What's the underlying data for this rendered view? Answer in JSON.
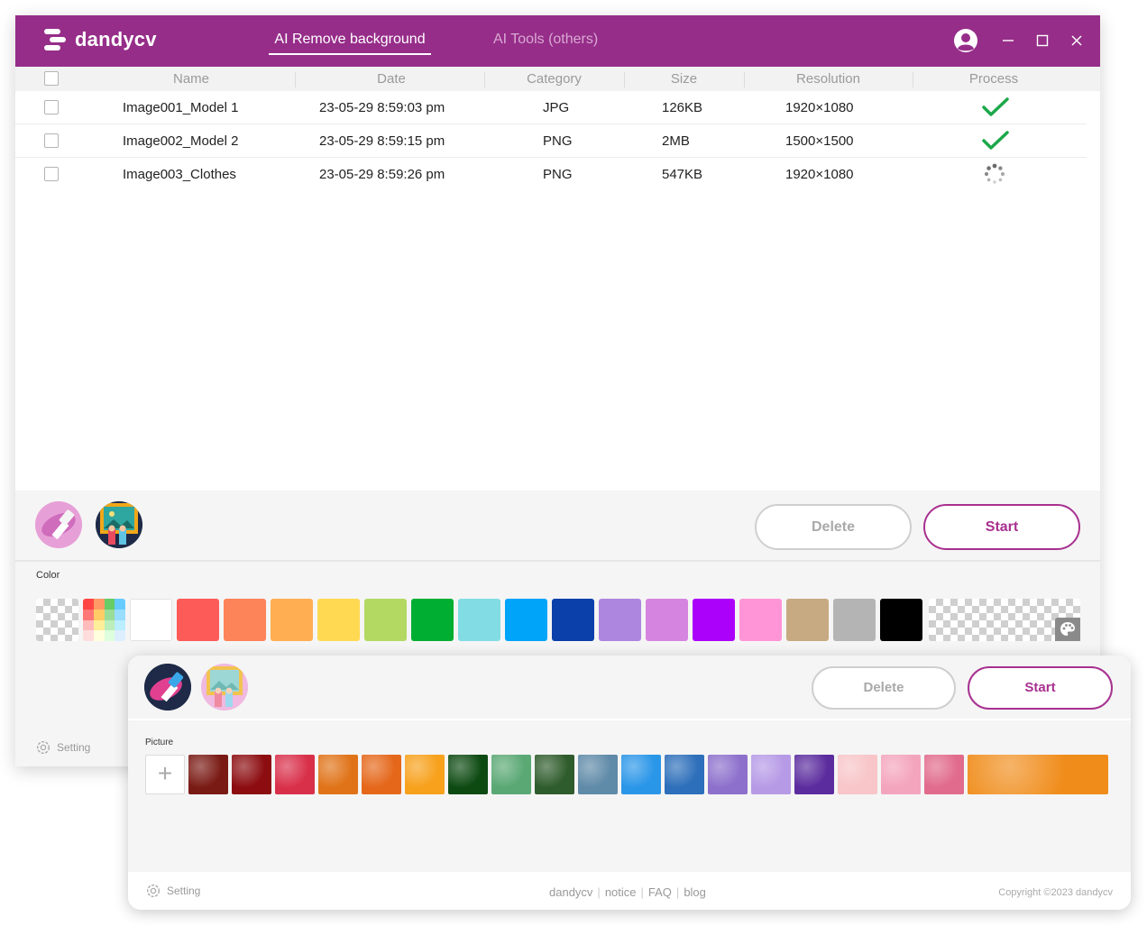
{
  "app": {
    "name": "dandycv"
  },
  "tabs": [
    {
      "label": "AI Remove background",
      "active": true
    },
    {
      "label": "AI Tools (others)",
      "active": false
    }
  ],
  "window_controls": [
    "account-icon",
    "minimize-icon",
    "maximize-icon",
    "close-icon"
  ],
  "table": {
    "columns": [
      "Name",
      "Date",
      "Category",
      "Size",
      "Resolution",
      "Process"
    ],
    "rows": [
      {
        "name": "Image001_Model 1",
        "date": "23-05-29 8:59:03 pm",
        "category": "JPG",
        "size": "126KB",
        "resolution": "1920×1080",
        "status": "done"
      },
      {
        "name": "Image002_Model 2",
        "date": "23-05-29 8:59:15 pm",
        "category": "PNG",
        "size": "2MB",
        "resolution": "1500×1500",
        "status": "done"
      },
      {
        "name": "Image003_Clothes",
        "date": "23-05-29 8:59:26 pm",
        "category": "PNG",
        "size": "547KB",
        "resolution": "1920×1080",
        "status": "processing"
      }
    ]
  },
  "actions": {
    "delete_label": "Delete",
    "start_label": "Start"
  },
  "color_panel": {
    "label": "Color",
    "swatches": [
      "transparent",
      "palette-grid",
      "#ffffff",
      "#fd5b58",
      "#fd8358",
      "#ffae52",
      "#ffd952",
      "#b3d963",
      "#00ae32",
      "#81dde3",
      "#00a4f9",
      "#0b3faa",
      "#ad86e0",
      "#d585e0",
      "#ab00f9",
      "#ff95d7",
      "#c7aa82",
      "#b4b4b4",
      "#000000",
      "transparent-wide"
    ]
  },
  "picture_panel": {
    "label": "Picture",
    "add_symbol": "+",
    "pictures": [
      {
        "name": "red-leaves",
        "color": "#7a1a14"
      },
      {
        "name": "red-fabric",
        "color": "#8c0c10"
      },
      {
        "name": "red-flowers",
        "color": "#d9304a"
      },
      {
        "name": "oranges-stack",
        "color": "#e07318"
      },
      {
        "name": "orange-stripes",
        "color": "#e5671a"
      },
      {
        "name": "orange-gradient",
        "color": "#f7a11c"
      },
      {
        "name": "dark-foliage",
        "color": "#0d4a12"
      },
      {
        "name": "green-leaves",
        "color": "#5aa874"
      },
      {
        "name": "palm-leaves",
        "color": "#2f5c2c"
      },
      {
        "name": "sky-clouds",
        "color": "#5f8aa8"
      },
      {
        "name": "blue-water",
        "color": "#2a96e8"
      },
      {
        "name": "blue-building",
        "color": "#2d6fba"
      },
      {
        "name": "purple-bokeh",
        "color": "#8d70cc"
      },
      {
        "name": "lavender-smoke",
        "color": "#b69ae6"
      },
      {
        "name": "purple-flowers",
        "color": "#5b2c9e"
      },
      {
        "name": "pink-petals",
        "color": "#f8c5c8"
      },
      {
        "name": "pink-blossom",
        "color": "#f4a5be"
      },
      {
        "name": "pink-rose",
        "color": "#e16b8c"
      },
      {
        "name": "oranges-wide",
        "color": "#f08c1a"
      }
    ]
  },
  "setting_label": "Setting",
  "footer": {
    "links": [
      "dandycv",
      "notice",
      "FAQ",
      "blog"
    ],
    "copyright": "Copyright ©2023 dandycv"
  },
  "colors": {
    "brand": "#962d89",
    "accent": "#a8308f",
    "success": "#1ca84a"
  }
}
